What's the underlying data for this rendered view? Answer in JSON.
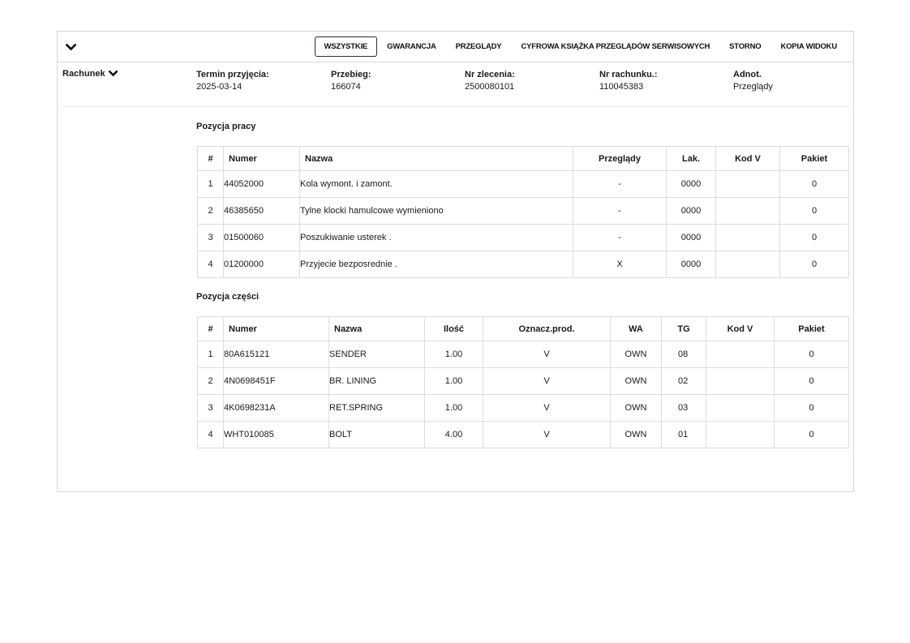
{
  "tabs": [
    {
      "label": "WSZYSTKIE",
      "active": true
    },
    {
      "label": "GWARANCJA",
      "active": false
    },
    {
      "label": "PRZEGLĄDY",
      "active": false
    },
    {
      "label": "CYFROWA KSIĄŻKA PRZEGLĄDÓW SERWISOWYCH",
      "active": false
    },
    {
      "label": "STORNO",
      "active": false
    },
    {
      "label": "KOPIA WIDOKU",
      "active": false
    }
  ],
  "invoice": {
    "toggle_label": "Rachunek",
    "fields": [
      {
        "label": "Termin przyjęcia:",
        "value": "2025-03-14"
      },
      {
        "label": "Przebieg:",
        "value": "166074"
      },
      {
        "label": "Nr zlecenia:",
        "value": "2500080101"
      },
      {
        "label": "Nr rachunku.:",
        "value": "110045383"
      },
      {
        "label": "Adnot.",
        "value": "Przeglądy"
      }
    ]
  },
  "work": {
    "title": "Pozycja pracy",
    "headers": [
      "#",
      "Numer",
      "Nazwa",
      "Przeglądy",
      "Lak.",
      "Kod V",
      "Pakiet"
    ],
    "rows": [
      [
        "1",
        "44052000",
        "Kola wymont. i zamont.",
        "-",
        "0000",
        "",
        "0"
      ],
      [
        "2",
        "46385650",
        "Tylne klocki hamulcowe wymieniono",
        "-",
        "0000",
        "",
        "0"
      ],
      [
        "3",
        "01500060",
        "Poszukiwanie usterek .",
        "-",
        "0000",
        "",
        "0"
      ],
      [
        "4",
        "01200000",
        "Przyjecie bezposrednie .",
        "X",
        "0000",
        "",
        "0"
      ]
    ]
  },
  "parts": {
    "title": "Pozycja części",
    "headers": [
      "#",
      "Numer",
      "Nazwa",
      "Ilość",
      "Oznacz.prod.",
      "WA",
      "TG",
      "Kod V",
      "Pakiet"
    ],
    "rows": [
      [
        "1",
        "80A615121",
        "SENDER",
        "1.00",
        "V",
        "OWN",
        "08",
        "",
        "0"
      ],
      [
        "2",
        "4N0698451F",
        "BR. LINING",
        "1.00",
        "V",
        "OWN",
        "02",
        "",
        "0"
      ],
      [
        "3",
        "4K0698231A",
        "RET.SPRING",
        "1.00",
        "V",
        "OWN",
        "03",
        "",
        "0"
      ],
      [
        "4",
        "WHT010085",
        "BOLT",
        "4.00",
        "V",
        "OWN",
        "01",
        "",
        "0"
      ]
    ]
  }
}
